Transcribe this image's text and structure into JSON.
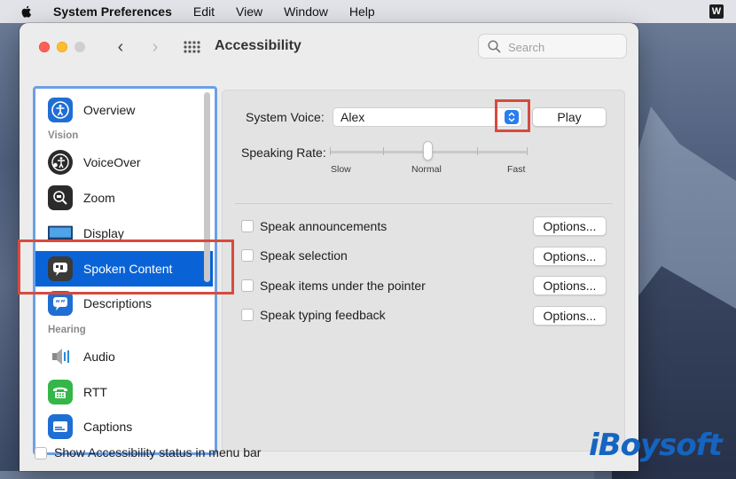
{
  "menubar": {
    "app_name": "System Preferences",
    "items": [
      "Edit",
      "View",
      "Window",
      "Help"
    ]
  },
  "window": {
    "title": "Accessibility",
    "search_placeholder": "Search"
  },
  "sidebar": {
    "items": [
      {
        "label": "Overview",
        "icon": "accessibility-icon"
      },
      {
        "label": "VoiceOver",
        "icon": "voiceover-icon"
      },
      {
        "label": "Zoom",
        "icon": "zoom-icon"
      },
      {
        "label": "Display",
        "icon": "display-icon"
      },
      {
        "label": "Spoken Content",
        "icon": "spoken-content-icon",
        "selected": true
      },
      {
        "label": "Descriptions",
        "icon": "descriptions-icon"
      },
      {
        "label": "Audio",
        "icon": "audio-icon"
      },
      {
        "label": "RTT",
        "icon": "rtt-icon"
      },
      {
        "label": "Captions",
        "icon": "captions-icon"
      }
    ],
    "headers": {
      "vision": "Vision",
      "hearing": "Hearing"
    }
  },
  "content": {
    "system_voice_label": "System Voice:",
    "system_voice_value": "Alex",
    "play_label": "Play",
    "speaking_rate_label": "Speaking Rate:",
    "rate_labels": {
      "slow": "Slow",
      "normal": "Normal",
      "fast": "Fast"
    },
    "speaking_rate_value": "Normal",
    "options": [
      {
        "label": "Speak announcements",
        "checked": false,
        "button": "Options..."
      },
      {
        "label": "Speak selection",
        "checked": false,
        "button": "Options..."
      },
      {
        "label": "Speak items under the pointer",
        "checked": false,
        "button": "Options..."
      },
      {
        "label": "Speak typing feedback",
        "checked": false,
        "button": "Options..."
      }
    ]
  },
  "footer": {
    "status_label": "Show Accessibility status in menu bar",
    "status_checked": false
  },
  "watermark": "iBoysoft",
  "colors": {
    "selection_blue": "#0a63d6",
    "annotation_red": "#d64b3f",
    "sidebar_outline": "#6d9fe6"
  }
}
